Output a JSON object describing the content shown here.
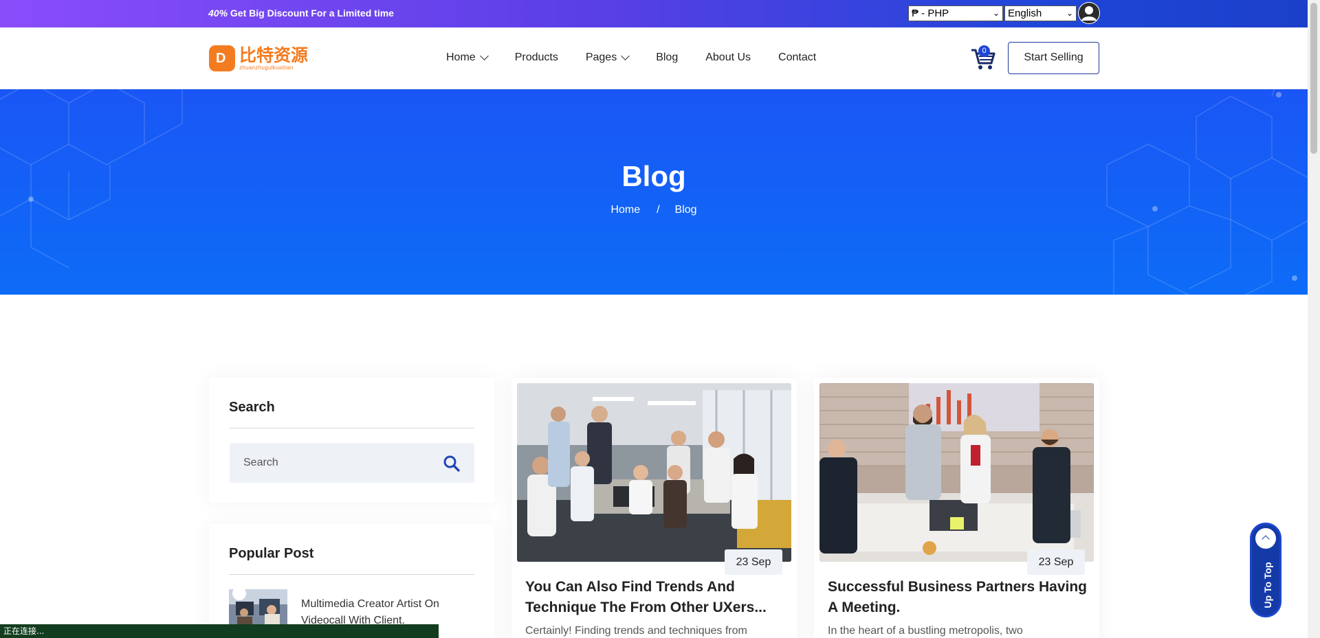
{
  "topbar": {
    "promo_strong": "40%",
    "promo_text": " Get Big Discount For a Limited time",
    "currency_selected": "₱ - PHP",
    "language_selected": "English"
  },
  "header": {
    "logo_cn": "比特资源",
    "logo_en": "zhuanzhuguikuaitian",
    "nav": [
      "Home",
      "Products",
      "Pages",
      "Blog",
      "About Us",
      "Contact"
    ],
    "cart_count": "0",
    "start_selling": "Start Selling"
  },
  "hero": {
    "title": "Blog",
    "breadcrumb": [
      "Home",
      "/",
      "Blog"
    ]
  },
  "sidebar": {
    "search_title": "Search",
    "search_placeholder": "Search",
    "popular_title": "Popular Post",
    "popular_posts": [
      {
        "title": "Multimedia Creator Artist On Videocall With Client."
      }
    ]
  },
  "posts": [
    {
      "date": "23 Sep",
      "title": "You Can Also Find Trends And Technique The From Other UXers...",
      "excerpt": "Certainly! Finding trends and techniques from"
    },
    {
      "date": "23 Sep",
      "title": "Successful Business Partners Having A Meeting.",
      "excerpt": "In the heart of a bustling metropolis, two"
    }
  ],
  "up_to_top": "Up To Top",
  "status_text": "正在连接..."
}
